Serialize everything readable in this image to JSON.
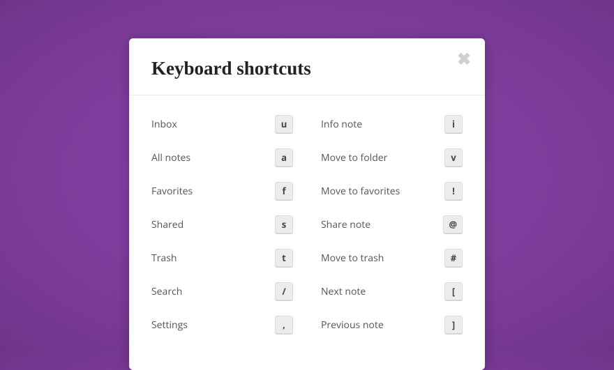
{
  "modal": {
    "title": "Keyboard shortcuts"
  },
  "leftCol": [
    {
      "label": "Inbox",
      "key": "u"
    },
    {
      "label": "All notes",
      "key": "a"
    },
    {
      "label": "Favorites",
      "key": "f"
    },
    {
      "label": "Shared",
      "key": "s"
    },
    {
      "label": "Trash",
      "key": "t"
    },
    {
      "label": "Search",
      "key": "/"
    },
    {
      "label": "Settings",
      "key": ","
    }
  ],
  "rightCol": [
    {
      "label": "Info note",
      "key": "i"
    },
    {
      "label": "Move to folder",
      "key": "v"
    },
    {
      "label": "Move to favorites",
      "key": "!"
    },
    {
      "label": "Share note",
      "key": "@"
    },
    {
      "label": "Move to trash",
      "key": "#"
    },
    {
      "label": "Next note",
      "key": "["
    },
    {
      "label": "Previous note",
      "key": "]"
    }
  ]
}
